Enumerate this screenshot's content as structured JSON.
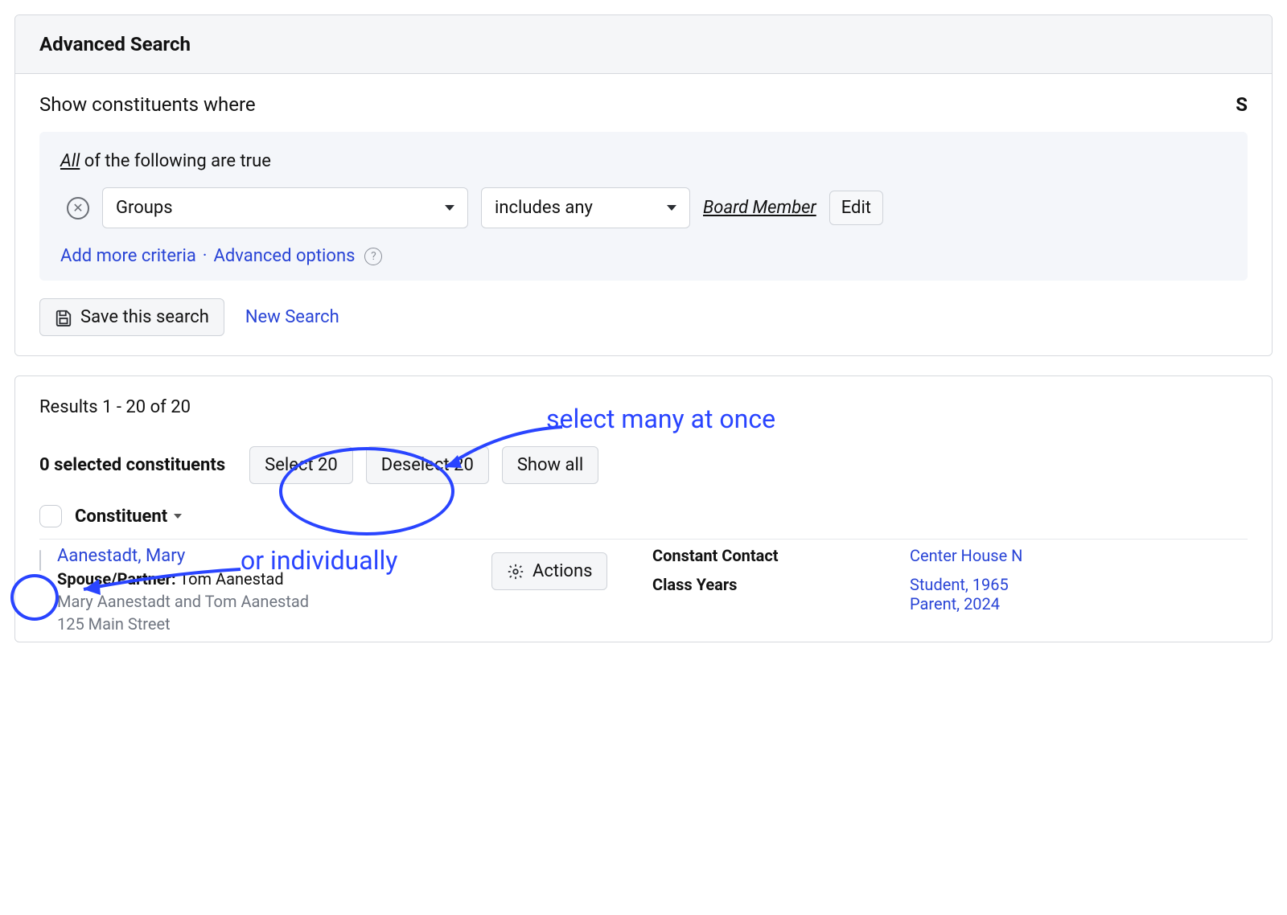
{
  "header": {
    "title": "Advanced Search"
  },
  "lead": {
    "text": "Show constituents where",
    "right_truncated": "S"
  },
  "criteria": {
    "quantifier_underlined": "All",
    "quantifier_rest": " of the following are true",
    "remove_label": "✕",
    "field_select": "Groups",
    "operator_select": "includes any",
    "value": "Board Member",
    "edit_button": "Edit",
    "add_more_link": "Add more criteria",
    "advanced_options_link": "Advanced options"
  },
  "actions": {
    "save_search": "Save this search",
    "new_search": "New Search"
  },
  "results": {
    "count_text": "Results 1 - 20 of 20",
    "selected_text": "0 selected constituents",
    "select_btn": "Select 20",
    "deselect_btn": "Deselect 20",
    "show_all_btn": "Show all",
    "col_constituent": "Constituent"
  },
  "row": {
    "name": "Aanestadt, Mary",
    "spouse_label": "Spouse/Partner:",
    "spouse_value": "Tom Aanestad",
    "combined_name": "Mary Aanestadt and Tom Aanestad",
    "address_line1": "125 Main Street",
    "actions_button": "Actions",
    "meta": {
      "cc_label": "Constant Contact",
      "cc_value": "Center House N",
      "cy_label": "Class Years",
      "cy_value1": "Student, 1965",
      "cy_value2": "Parent, 2024"
    }
  },
  "annotations": {
    "many": "select many at once",
    "individually": "or individually"
  }
}
